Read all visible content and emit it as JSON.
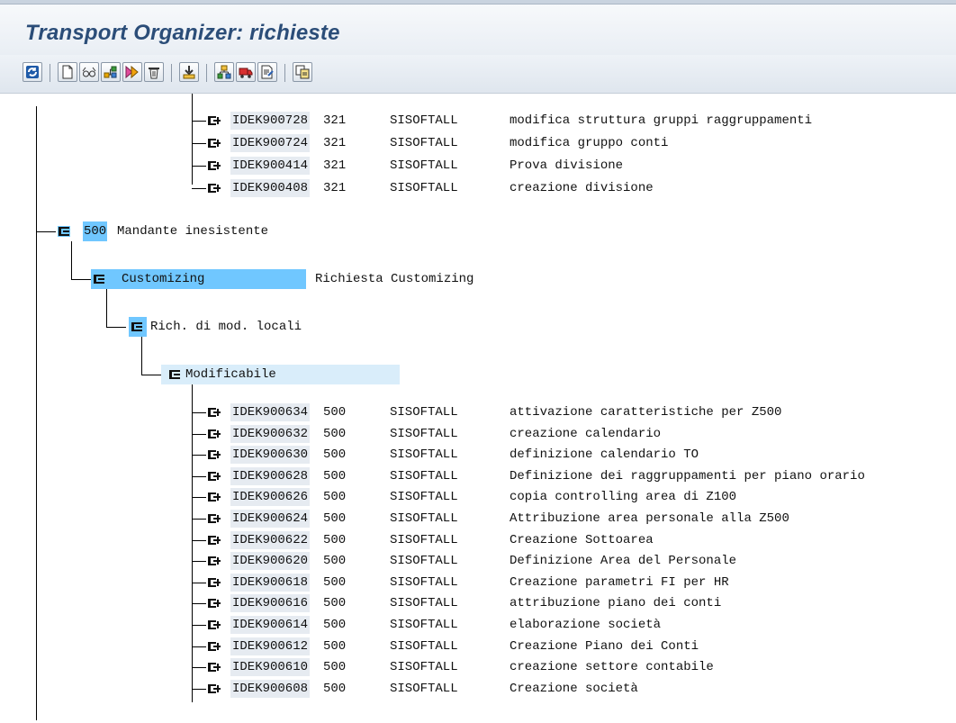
{
  "window": {
    "title": "Transport Organizer: richieste"
  },
  "toolbar": {
    "buttons": [
      {
        "name": "refresh-button",
        "icon": "refresh-icon"
      },
      {
        "name": "create-button",
        "icon": "new-document-icon"
      },
      {
        "name": "change-display-button",
        "icon": "glasses-icon"
      },
      {
        "name": "add-user-button",
        "icon": "tree-icon"
      },
      {
        "name": "release-button",
        "icon": "forward-icon"
      },
      {
        "name": "delete-button",
        "icon": "trash-icon"
      },
      {
        "name": "import-button",
        "icon": "import-icon"
      },
      {
        "name": "object-list-button",
        "icon": "hierarchy-icon"
      },
      {
        "name": "transport-button",
        "icon": "truck-icon"
      },
      {
        "name": "log-button",
        "icon": "log-icon"
      },
      {
        "name": "copy-button",
        "icon": "copy-icon"
      }
    ]
  },
  "tree": {
    "upper_tasks": [
      {
        "id": "IDEK900728",
        "client": "321",
        "owner": "SISOFTALL",
        "desc": "modifica struttura gruppi raggruppamenti"
      },
      {
        "id": "IDEK900724",
        "client": "321",
        "owner": "SISOFTALL",
        "desc": "modifica gruppo conti"
      },
      {
        "id": "IDEK900414",
        "client": "321",
        "owner": "SISOFTALL",
        "desc": "Prova divisione"
      },
      {
        "id": "IDEK900408",
        "client": "321",
        "owner": "SISOFTALL",
        "desc": "creazione divisione"
      }
    ],
    "client_node": {
      "number": "500",
      "label": "Mandante inesistente"
    },
    "category_node": {
      "label": "Customizing",
      "desc": "Richiesta Customizing"
    },
    "local_node": {
      "label": "Rich. di mod. locali"
    },
    "status_node": {
      "label": "Modificabile"
    },
    "tasks": [
      {
        "id": "IDEK900634",
        "client": "500",
        "owner": "SISOFTALL",
        "desc": "attivazione caratteristiche per Z500"
      },
      {
        "id": "IDEK900632",
        "client": "500",
        "owner": "SISOFTALL",
        "desc": "creazione calendario"
      },
      {
        "id": "IDEK900630",
        "client": "500",
        "owner": "SISOFTALL",
        "desc": "definizione calendario TO"
      },
      {
        "id": "IDEK900628",
        "client": "500",
        "owner": "SISOFTALL",
        "desc": "Definizione dei raggruppamenti per piano orario"
      },
      {
        "id": "IDEK900626",
        "client": "500",
        "owner": "SISOFTALL",
        "desc": "copia controlling area di Z100"
      },
      {
        "id": "IDEK900624",
        "client": "500",
        "owner": "SISOFTALL",
        "desc": "Attribuzione area personale alla Z500"
      },
      {
        "id": "IDEK900622",
        "client": "500",
        "owner": "SISOFTALL",
        "desc": "Creazione Sottoarea"
      },
      {
        "id": "IDEK900620",
        "client": "500",
        "owner": "SISOFTALL",
        "desc": "Definizione Area del Personale"
      },
      {
        "id": "IDEK900618",
        "client": "500",
        "owner": "SISOFTALL",
        "desc": "Creazione parametri FI per HR"
      },
      {
        "id": "IDEK900616",
        "client": "500",
        "owner": "SISOFTALL",
        "desc": "attribuzione piano dei conti"
      },
      {
        "id": "IDEK900614",
        "client": "500",
        "owner": "SISOFTALL",
        "desc": "elaborazione società"
      },
      {
        "id": "IDEK900612",
        "client": "500",
        "owner": "SISOFTALL",
        "desc": "Creazione Piano dei Conti"
      },
      {
        "id": "IDEK900610",
        "client": "500",
        "owner": "SISOFTALL",
        "desc": "creazione settore contabile"
      },
      {
        "id": "IDEK900608",
        "client": "500",
        "owner": "SISOFTALL",
        "desc": "Creazione società"
      }
    ]
  },
  "colors": {
    "title": "#2b4d78",
    "selection": "#70c7ff",
    "selection_light": "#d9edfa"
  }
}
